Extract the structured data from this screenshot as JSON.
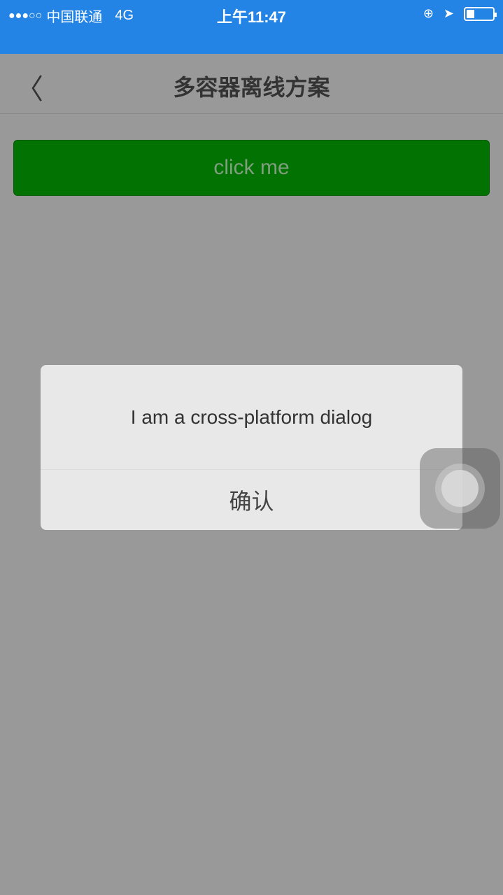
{
  "status_bar": {
    "signal": "●●●○○",
    "carrier": "中国联通",
    "network": "4G",
    "time": "上午11:47",
    "rotation_lock_icon": "lock-rotation-icon",
    "location_icon": "location-arrow-icon",
    "battery_level": 0.3
  },
  "nav": {
    "back_icon": "chevron-left-icon",
    "back_glyph": "〈",
    "title": "多容器离线方案"
  },
  "main": {
    "button_label": "click me"
  },
  "dialog": {
    "message": "I am a cross-platform dialog",
    "confirm_label": "确认"
  },
  "colors": {
    "status_bar": "#2384e6",
    "button": "#027302",
    "overlay": "#999999"
  }
}
